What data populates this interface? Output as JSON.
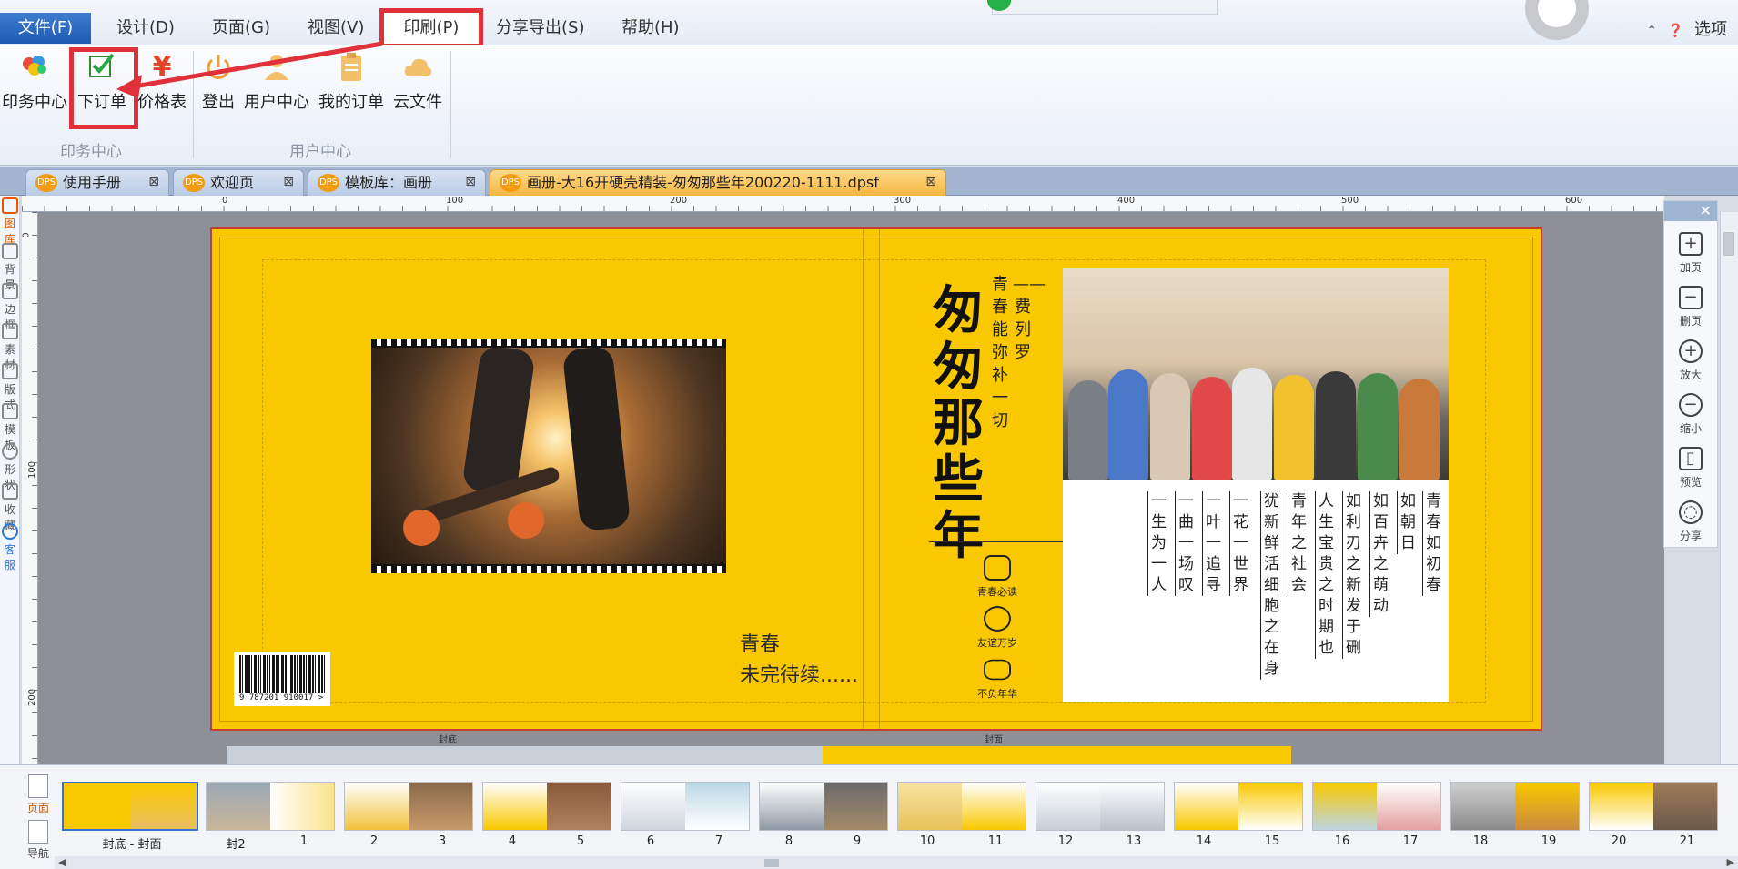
{
  "menubar": {
    "file": "文件(F)",
    "items": [
      "设计(D)",
      "页面(G)",
      "视图(V)",
      "印刷(P)",
      "分享导出(S)",
      "帮助(H)"
    ],
    "options": "选项"
  },
  "ribbon": {
    "print_center": "印务中心",
    "place_order": "下订单",
    "price_list": "价格表",
    "logout": "登出",
    "user_center": "用户中心",
    "my_orders": "我的订单",
    "cloud_files": "云文件",
    "group1": "印务中心",
    "group2": "用户中心"
  },
  "tabs": [
    {
      "label": "使用手册"
    },
    {
      "label": "欢迎页"
    },
    {
      "label": "模板库：画册"
    },
    {
      "label": "画册-大16开硬壳精装-匆匆那些年200220-1111.dpsf"
    }
  ],
  "tab_icon": "DPS",
  "leftpanel": [
    "图库",
    "背景",
    "边框",
    "素材",
    "版式",
    "模板",
    "形状",
    "收藏",
    "客服"
  ],
  "ruler": {
    "h": [
      "0",
      "100",
      "200",
      "300",
      "400",
      "500",
      "600"
    ],
    "v": [
      "0",
      "100",
      "200"
    ]
  },
  "cover": {
    "barcode_digits": "9 787201 910017 >",
    "back_line1": "青春",
    "back_line2": "未完待续......",
    "title": "匆匆那些年",
    "sub1": "青春能弥补一切",
    "sub2": "——费列罗",
    "badge1": "青春必读",
    "badge2": "友谊万岁",
    "badge3": "不负年华",
    "poem": [
      "一生为一人",
      "一曲一场叹",
      "一叶一追寻",
      "一花一世界",
      "犹新鲜活细胞之在身",
      "青年之社会",
      "人生宝贵之时期也",
      "如利刃之新发于硎",
      "如百卉之萌动",
      "如朝日",
      "青春如初春"
    ],
    "label_back": "封底",
    "label_front": "封面"
  },
  "righttool": [
    "加页",
    "删页",
    "放大",
    "缩小",
    "预览",
    "分享"
  ],
  "thumbbar": {
    "side": [
      "页面",
      "导航"
    ],
    "labels": [
      "封底 - 封面",
      "封2",
      "1",
      "2",
      "3",
      "4",
      "5",
      "6",
      "7",
      "8",
      "9",
      "10",
      "11",
      "12",
      "13",
      "14",
      "15",
      "16",
      "17",
      "18",
      "19",
      "20",
      "21"
    ]
  },
  "colors": {
    "accent_red": "#e0303a",
    "cover_yellow": "#f9c800"
  }
}
